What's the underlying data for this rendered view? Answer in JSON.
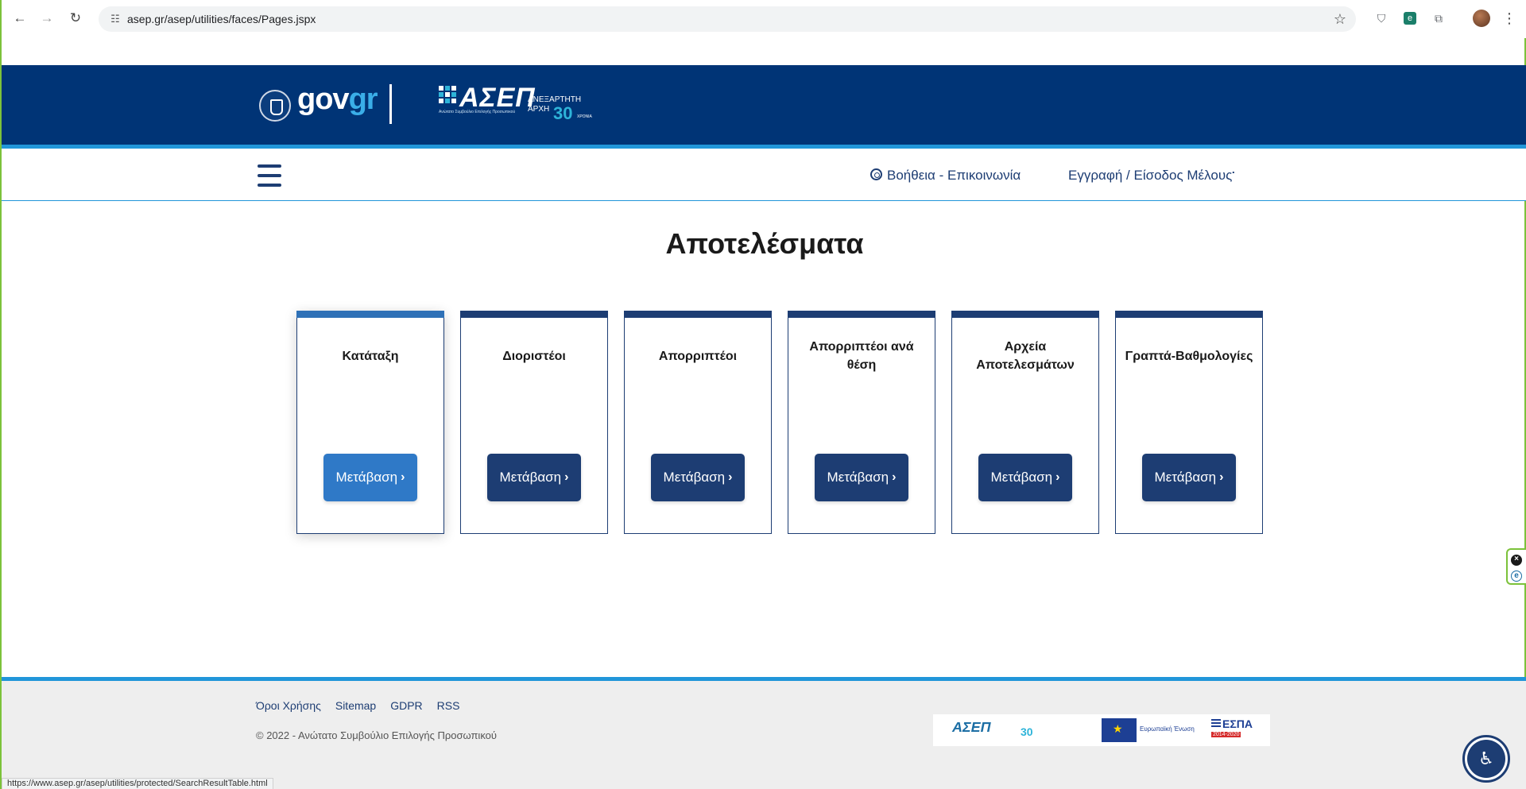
{
  "browser": {
    "url": "asep.gr/asep/utilities/faces/Pages.jspx",
    "status_url": "https://www.asep.gr/asep/utilities/protected/SearchResultTable.html",
    "icons": [
      "back-icon",
      "forward-icon",
      "reload-icon",
      "site-info-icon",
      "star-icon",
      "shield-extension-icon",
      "green-extension-icon",
      "puzzle-icon",
      "profile-avatar",
      "menu-dots-icon"
    ]
  },
  "header": {
    "gov_logo_a": "gov",
    "gov_logo_b": "gr",
    "asep_logo": "ΑΣΕΠ",
    "asep_subtitle": "Ανώτατο Συμβούλιο Επιλογής Προσωπικού",
    "asep_independent_1": "ΑΝΕΞΑΡΤΗΤΗ",
    "asep_independent_2": "ΑΡΧΗ",
    "asep_years": "30",
    "asep_years_small": "ΧΡΟΝΙΑ"
  },
  "nav": {
    "help": "Βοήθεια - Επικοινωνία",
    "login": "Εγγραφή / Είσοδος Μέλους"
  },
  "page": {
    "title": "Αποτελέσματα"
  },
  "cards": [
    {
      "title": "Κατάταξη",
      "button": "Μετάβαση"
    },
    {
      "title": "Διοριστέοι",
      "button": "Μετάβαση"
    },
    {
      "title": "Απορριπτέοι",
      "button": "Μετάβαση"
    },
    {
      "title": "Απορριπτέοι ανά θέση",
      "button": "Μετάβαση"
    },
    {
      "title": "Αρχεία Αποτελεσμάτων",
      "button": "Μετάβαση"
    },
    {
      "title": "Γραπτά-Βαθμολογίες",
      "button": "Μετάβαση"
    }
  ],
  "footer": {
    "links": [
      "Όροι Χρήσης",
      "Sitemap",
      "GDPR",
      "RSS"
    ],
    "copyright": "© 2022 - Ανώτατο Συμβούλιο Επιλογής Προσωπικού",
    "logo_asep": "ΑΣΕΠ",
    "logo_asep_years": "30",
    "logo_eu": "Ευρωπαϊκή Ένωση",
    "logo_espa": "ΕΣΠΑ",
    "logo_espa_years": "2014-2020"
  },
  "colors": {
    "header_blue": "#003476",
    "accent_blue": "#2196d9",
    "card_navy": "#1d3d73",
    "active_blue": "#2f79c7"
  }
}
